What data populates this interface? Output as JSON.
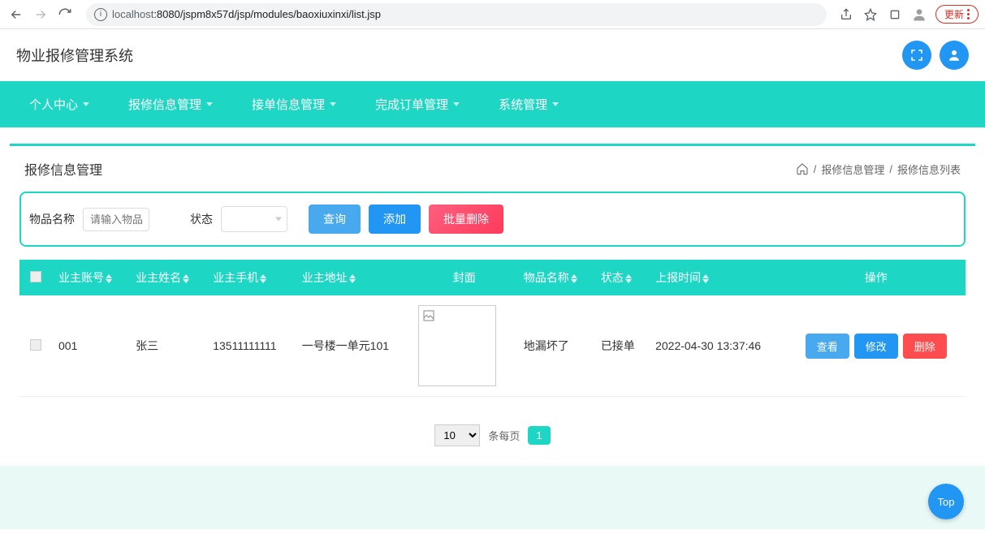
{
  "browser": {
    "url_prefix": "localhost",
    "url_rest": ":8080/jspm8x57d/jsp/modules/baoxiuxinxi/list.jsp",
    "update": "更新"
  },
  "header": {
    "title": "物业报修管理系统"
  },
  "nav": {
    "items": [
      "个人中心",
      "报修信息管理",
      "接单信息管理",
      "完成订单管理",
      "系统管理"
    ]
  },
  "page": {
    "title": "报修信息管理",
    "crumb1": "报修信息管理",
    "crumb2": "报修信息列表",
    "sep": "/"
  },
  "search": {
    "name_label": "物品名称",
    "name_placeholder": "请输入物品",
    "status_label": "状态",
    "query": "查询",
    "add": "添加",
    "batch_delete": "批量删除"
  },
  "table": {
    "headers": {
      "account": "业主账号",
      "name": "业主姓名",
      "phone": "业主手机",
      "address": "业主地址",
      "cover": "封面",
      "item": "物品名称",
      "status": "状态",
      "time": "上报时间",
      "ops": "操作"
    },
    "rows": [
      {
        "account": "001",
        "name": "张三",
        "phone": "13511111111",
        "address": "一号楼一单元101",
        "item": "地漏坏了",
        "status": "已接单",
        "time": "2022-04-30 13:37:46"
      }
    ],
    "actions": {
      "view": "查看",
      "edit": "修改",
      "delete": "删除"
    }
  },
  "pagination": {
    "size": "10",
    "label": "条每页",
    "page": "1"
  },
  "top": "Top"
}
